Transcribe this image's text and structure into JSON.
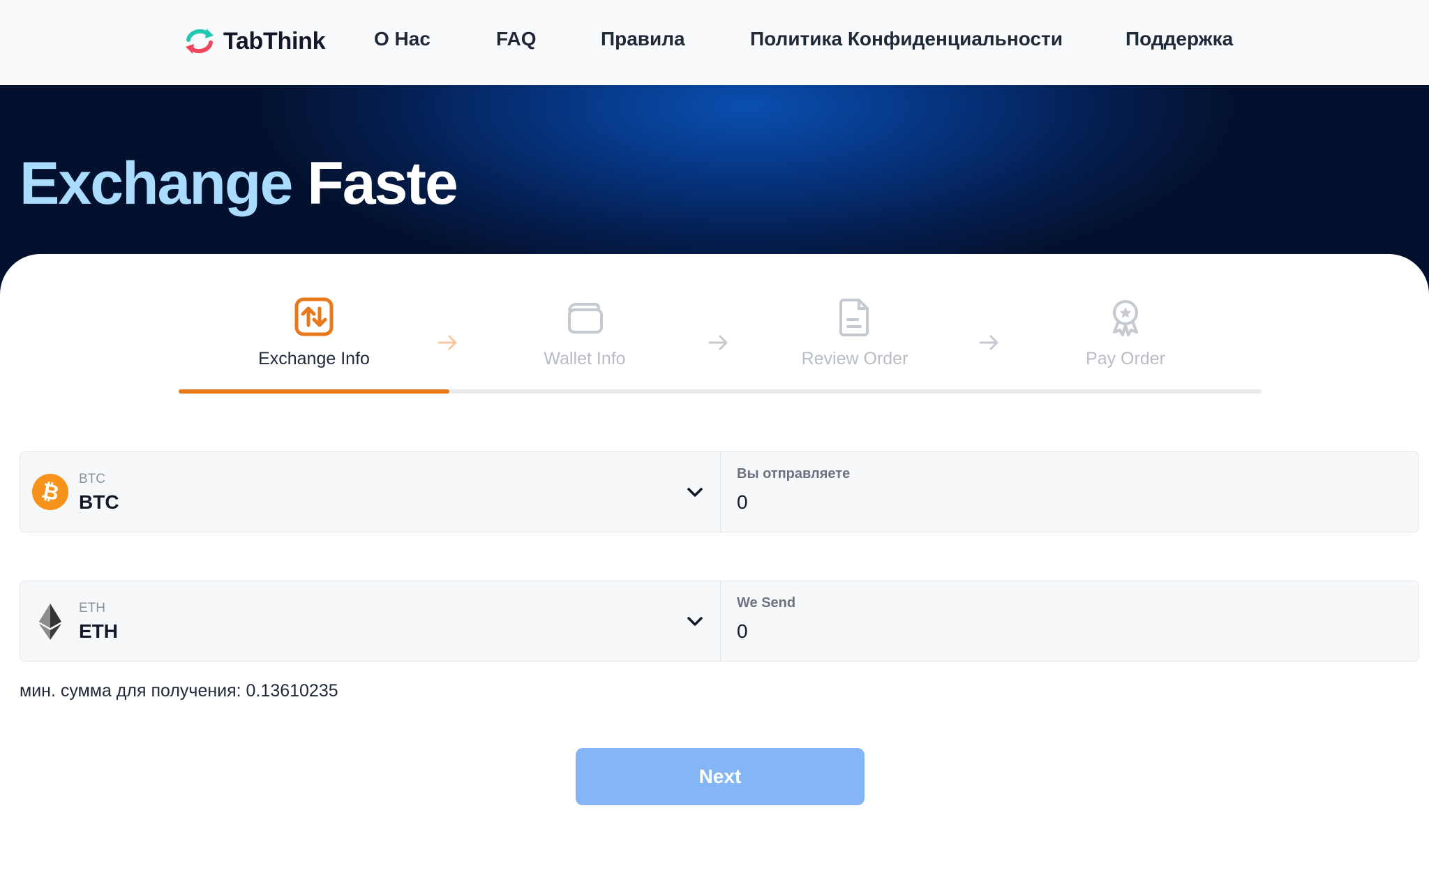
{
  "brand": {
    "name": "TabThink"
  },
  "nav": [
    {
      "label": "О Нас"
    },
    {
      "label": "FAQ"
    },
    {
      "label": "Правила"
    },
    {
      "label": "Политика Конфиденциальности"
    },
    {
      "label": "Поддержка"
    }
  ],
  "hero": {
    "title_part1": "Exchange",
    "title_part2": "Faste"
  },
  "steps": [
    {
      "label": "Exchange Info",
      "icon": "exchange-arrows-icon",
      "active": true
    },
    {
      "label": "Wallet Info",
      "icon": "wallet-icon",
      "active": false
    },
    {
      "label": "Review Order",
      "icon": "document-icon",
      "active": false
    },
    {
      "label": "Pay Order",
      "icon": "award-badge-icon",
      "active": false
    }
  ],
  "progress": {
    "completed_steps": 1,
    "total_steps": 4
  },
  "send": {
    "currency_code": "BTC",
    "currency_name": "BTC",
    "icon": "bitcoin-icon",
    "amount_label": "Вы отправляете",
    "amount_value": "0"
  },
  "receive": {
    "currency_code": "ETH",
    "currency_name": "ETH",
    "icon": "ethereum-icon",
    "amount_label": "We Send",
    "amount_value": "0"
  },
  "min_note": "мин. сумма для получения: 0.13610235",
  "next_button": "Next",
  "colors": {
    "accent_orange": "#e8791a",
    "button_blue": "#84b6f6",
    "hero_light": "#a9dcff"
  }
}
